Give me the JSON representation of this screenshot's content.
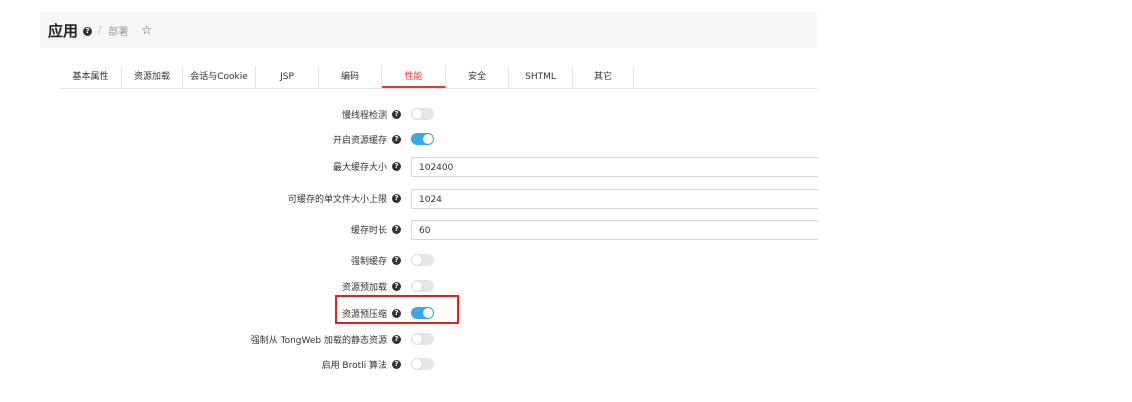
{
  "header": {
    "title": "应用",
    "breadcrumb_sep": "/",
    "breadcrumb": "部署",
    "star": "☆"
  },
  "tabs": [
    {
      "label": "基本属性",
      "active": false
    },
    {
      "label": "资源加载",
      "active": false
    },
    {
      "label": "会话与Cookie",
      "active": false
    },
    {
      "label": "JSP",
      "active": false
    },
    {
      "label": "编码",
      "active": false
    },
    {
      "label": "性能",
      "active": true
    },
    {
      "label": "安全",
      "active": false
    },
    {
      "label": "SHTML",
      "active": false
    },
    {
      "label": "其它",
      "active": false
    }
  ],
  "form": {
    "slow_thread_detect": {
      "label": "慢线程检测",
      "enabled": false
    },
    "enable_cache": {
      "label": "开启资源缓存",
      "enabled": true
    },
    "max_cache_size": {
      "label": "最大缓存大小",
      "value": "102400"
    },
    "max_file_size": {
      "label": "可缓存的单文件大小上限",
      "value": "1024"
    },
    "cache_ttl": {
      "label": "缓存时长",
      "value": "60"
    },
    "force_cache": {
      "label": "强制缓存",
      "enabled": false
    },
    "preload": {
      "label": "资源预加载",
      "enabled": false
    },
    "precompress": {
      "label": "资源预压缩",
      "enabled": true
    },
    "force_tongweb_static": {
      "label": "强制从 TongWeb 加载的静态资源",
      "enabled": false
    },
    "brotli": {
      "label": "启用 Brotli 算法",
      "enabled": false
    }
  },
  "help_glyph": "?",
  "colors": {
    "accent": "#e4393c",
    "toggle_on": "#3aa8e8",
    "highlight": "#e02020"
  }
}
